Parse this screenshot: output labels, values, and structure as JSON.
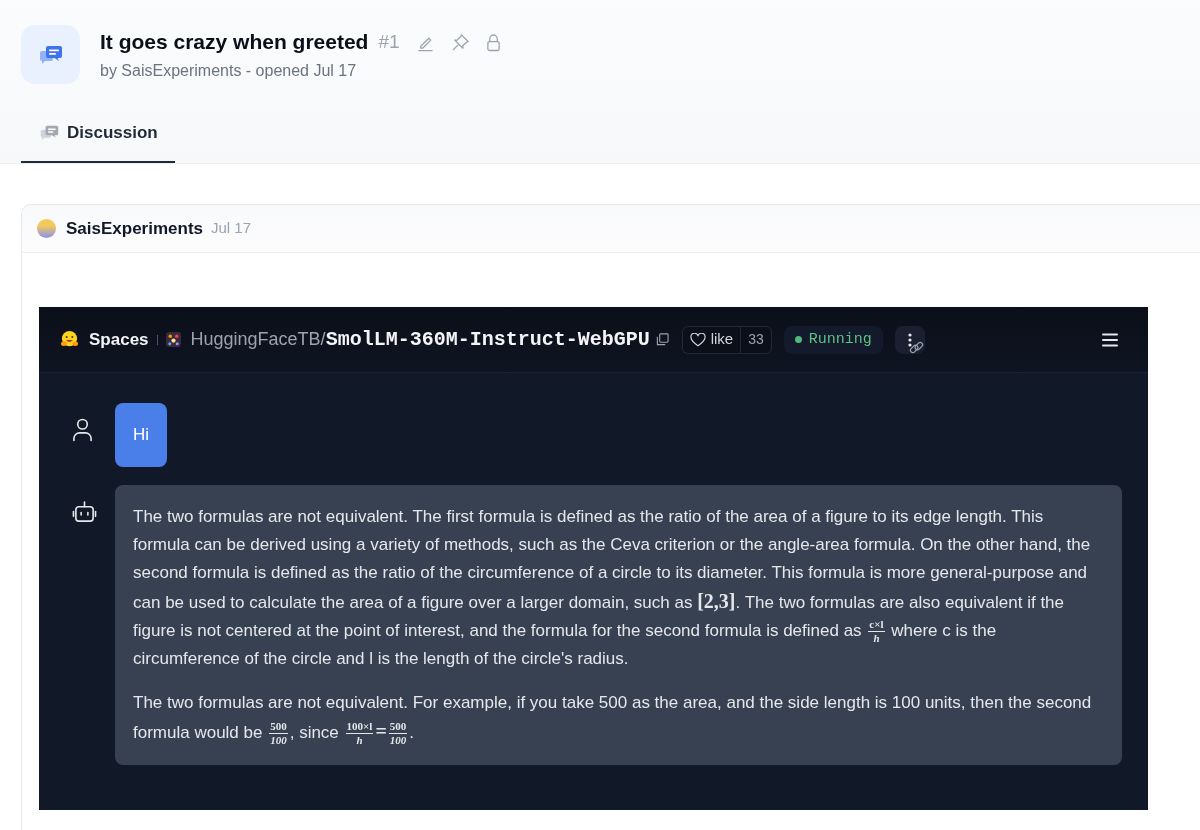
{
  "discussion": {
    "title": "It goes crazy when greeted",
    "number": "#1",
    "byline": "by SaisExperiments - opened Jul 17"
  },
  "tabs": [
    {
      "label": "Discussion",
      "selected": true
    }
  ],
  "comment": {
    "author": "SaisExperiments",
    "date": "Jul 17",
    "screenshot": {
      "app_bar": {
        "brand": "Spaces",
        "owner": "HuggingFaceTB/",
        "space_name": "SmolLM-360M-Instruct-WebGPU",
        "like_label": "like",
        "like_count": "33",
        "status": "Running"
      },
      "messages": [
        {
          "kind": "user",
          "paragraphs": [
            [
              {
                "kind": "text",
                "text": "Hi"
              }
            ]
          ]
        },
        {
          "kind": "assistant",
          "paragraphs": [
            [
              {
                "kind": "text",
                "text": "The two formulas are not equivalent. The first formula is defined as the ratio of the area of a figure to its edge length. This formula can be derived using a variety of methods, such as the Ceva criterion or the angle-area formula. On the other hand, the second formula is defined as the ratio of the circumference of a circle to its diameter. This formula is more general-purpose and can be used to calculate the area of a figure over a larger domain, such as "
              },
              {
                "kind": "math",
                "text": "[2,3]"
              },
              {
                "kind": "text",
                "text": ". The two formulas are also equivalent if the figure is not centered at the point of interest, and the formula for the second formula is defined as "
              },
              {
                "kind": "fraction",
                "numerator": "c×l",
                "denominator": "h"
              },
              {
                "kind": "text",
                "text": " where c is the circumference of the circle and l is the length of the circle's radius."
              }
            ],
            [
              {
                "kind": "text",
                "text": "The two formulas are not equivalent. For example, if you take 500 as the area, and the side length is 100 units, then the second formula would be "
              },
              {
                "kind": "fraction",
                "numerator": "500",
                "denominator": "100"
              },
              {
                "kind": "text",
                "text": ", since "
              },
              {
                "kind": "fraction",
                "numerator": "100×l",
                "denominator": "h"
              },
              {
                "kind": "math",
                "text": "="
              },
              {
                "kind": "fraction",
                "numerator": "500",
                "denominator": "100"
              },
              {
                "kind": "text",
                "text": "."
              }
            ]
          ]
        }
      ]
    }
  }
}
